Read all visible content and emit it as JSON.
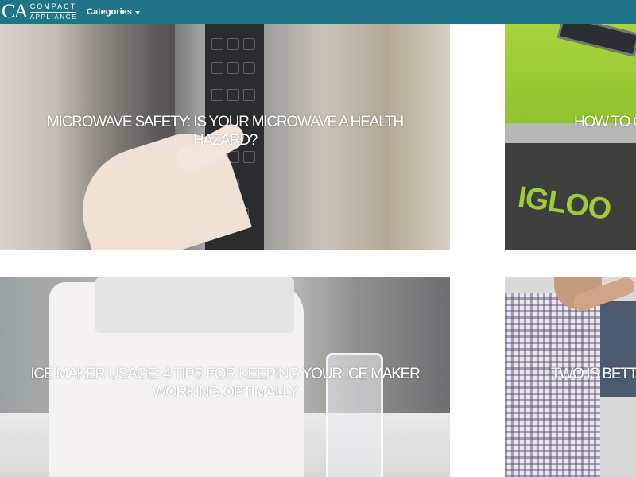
{
  "brand": {
    "logo_mark": "CA",
    "logo_line1": "COMPACT",
    "logo_line2": "APPLIANCE"
  },
  "nav": {
    "categories_label": "Categories"
  },
  "colors": {
    "navbar": "#1f7487",
    "text": "#ffffff"
  },
  "articles": [
    {
      "title": "MICROWAVE SAFETY: IS YOUR MICROWAVE A HEALTH HAZARD?"
    },
    {
      "title": "HOW TO C"
    },
    {
      "title": "ICE MAKER USAGE: 4 TIPS FOR KEEPING YOUR ICE MAKER WORKING OPTIMALLY"
    },
    {
      "title": "TWO IS BETT"
    }
  ],
  "icons": {
    "categories_caret": "chevron-down-icon"
  }
}
